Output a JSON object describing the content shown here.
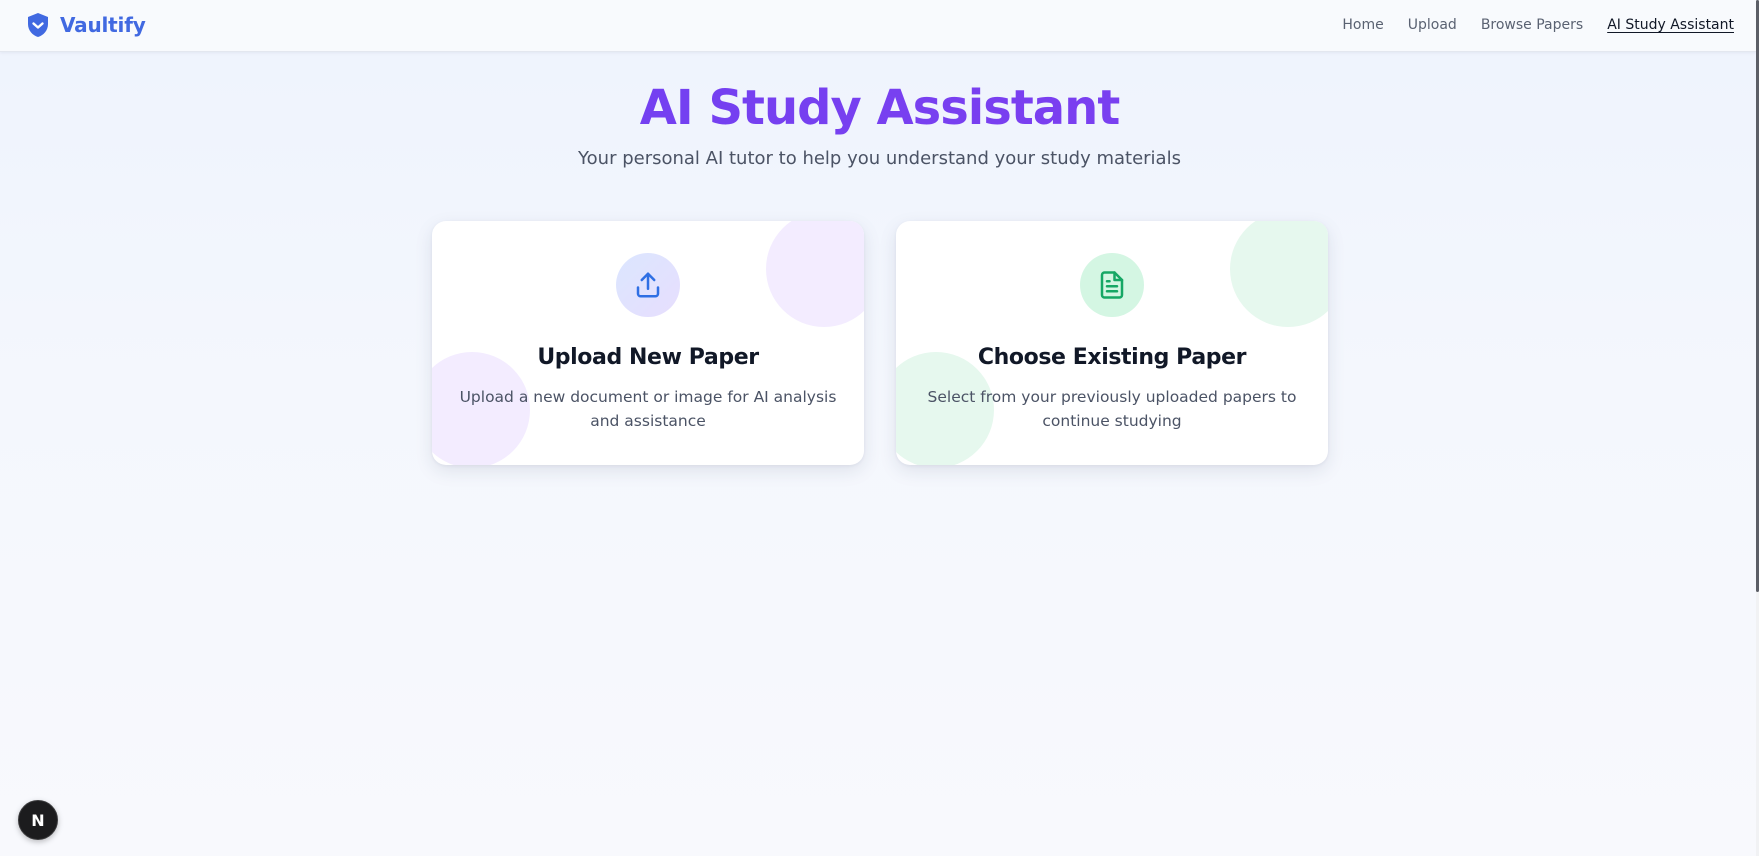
{
  "header": {
    "brand": {
      "name": "Vaultify",
      "icon": "shield-check-icon",
      "color": "#4169e1"
    },
    "nav": [
      {
        "label": "Home",
        "active": false
      },
      {
        "label": "Upload",
        "active": false
      },
      {
        "label": "Browse Papers",
        "active": false
      },
      {
        "label": "AI Study Assistant",
        "active": true
      }
    ]
  },
  "hero": {
    "title": "AI Study Assistant",
    "subtitle": "Your personal AI tutor to help you understand your study materials",
    "title_color": "#6f40f2"
  },
  "cards": [
    {
      "title": "Upload New Paper",
      "description": "Upload a new document or image for AI analysis and assistance",
      "icon": "upload-icon",
      "accent": "#2f6fe4"
    },
    {
      "title": "Choose Existing Paper",
      "description": "Select from your previously uploaded papers to continue studying",
      "icon": "document-icon",
      "accent": "#16a765"
    }
  ],
  "dev_badge": {
    "label": "N",
    "icon": "nextjs-icon"
  }
}
